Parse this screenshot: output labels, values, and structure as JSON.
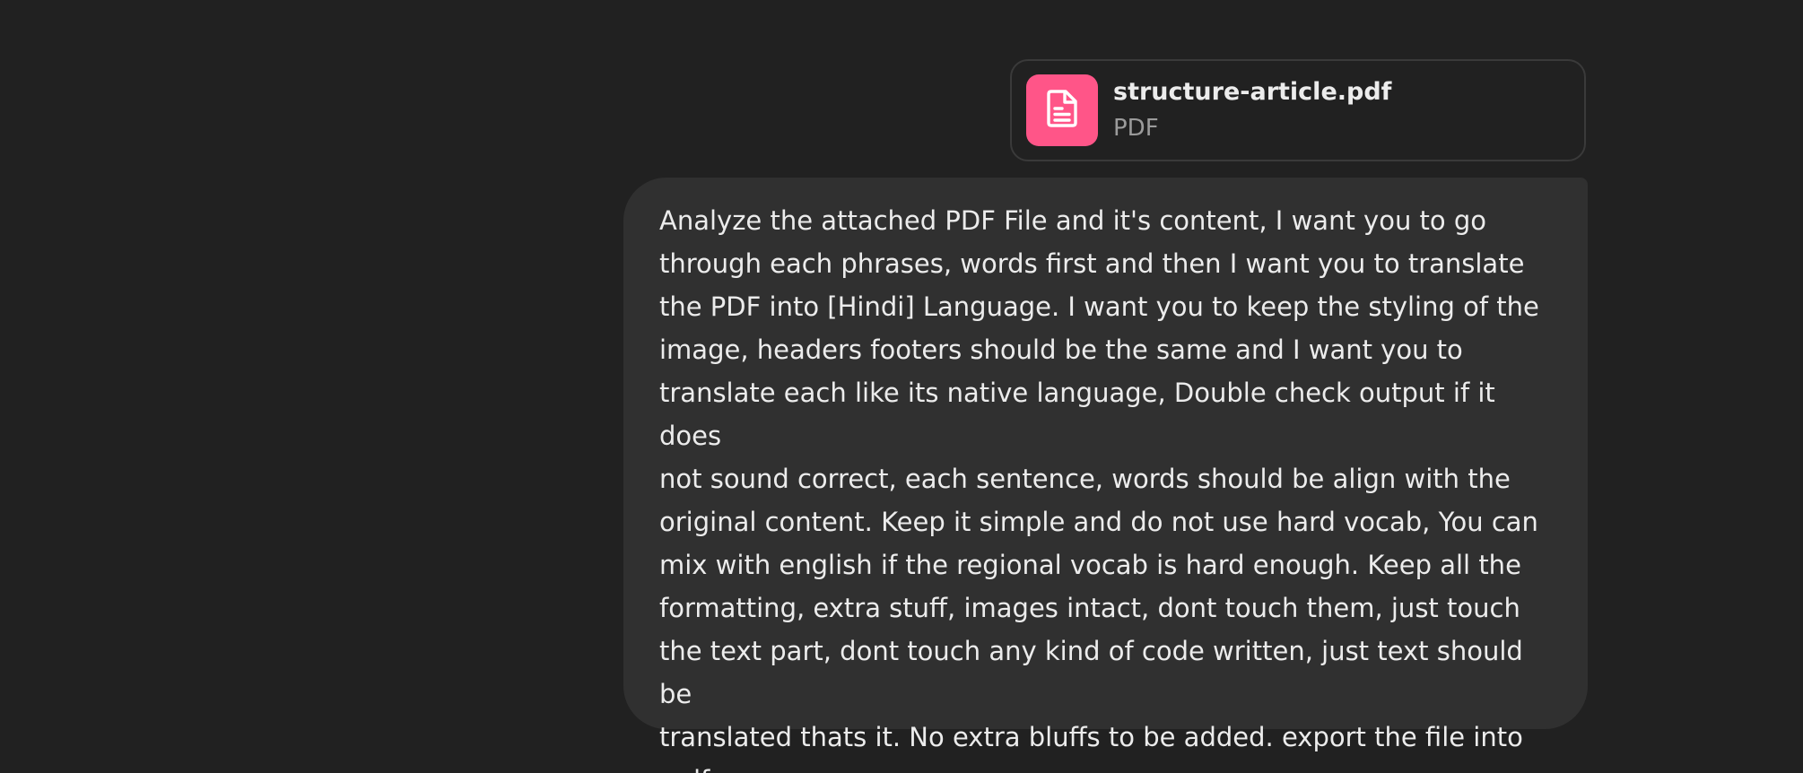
{
  "attachment": {
    "file_name": "structure-article.pdf",
    "file_type": "PDF",
    "icon": "document-icon",
    "icon_bg_color": "#ff5588"
  },
  "message": {
    "text": "Analyze the attached PDF File and it's content, I want you to go\nthrough each phrases, words first and then I want you to translate\nthe PDF into [Hindi] Language. I want you to keep the styling of the\nimage, headers footers should be the same and I want you to\ntranslate each like its native language, Double check output if it does\nnot sound correct, each sentence, words should be align with the\noriginal content. Keep it simple and do not use hard vocab, You can\nmix with english if the regional vocab is hard enough. Keep all the\nformatting, extra stuff, images intact, dont touch them, just touch\nthe text part, dont touch any kind of code written, just text should be\ntranslated thats it. No extra bluffs to be added. export the file into\n.pdf."
  },
  "colors": {
    "background": "#212121",
    "bubble": "#303030",
    "text": "#ececec",
    "muted_text": "#9b9b9b",
    "card_border": "#3a3a3a"
  }
}
